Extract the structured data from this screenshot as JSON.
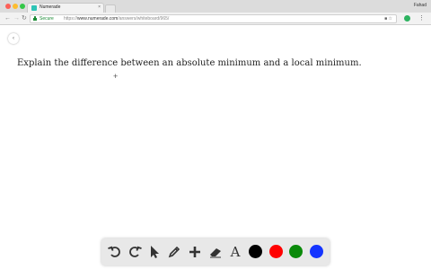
{
  "browser": {
    "tab_title": "Numerade",
    "tab_close": "×",
    "profile_name": "Fahad",
    "secure_label": "Secure",
    "url_scheme": "https://",
    "url_host": "www.numerade.com",
    "url_path": "/answers/whiteboard/965/"
  },
  "page": {
    "collapse_icon": "‹",
    "question": "Explain the difference between an absolute minimum and a local minimum.",
    "cursor": "+"
  },
  "toolbar": {
    "tools": [
      "undo-icon",
      "redo-icon",
      "pointer-icon",
      "pencil-icon",
      "plus-icon",
      "eraser-icon",
      "text-icon"
    ],
    "text_tool_label": "A",
    "colors": {
      "black": "#000000",
      "red": "#ff0000",
      "green": "#0a8a0a",
      "blue": "#1434ff"
    }
  }
}
